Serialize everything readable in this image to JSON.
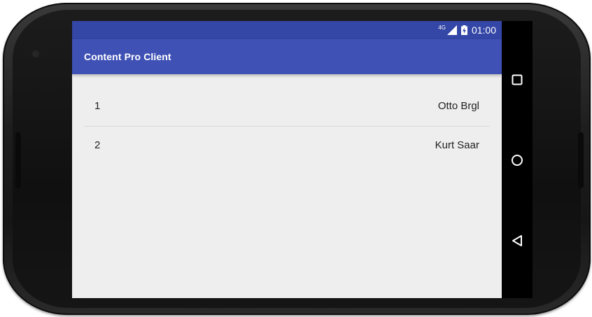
{
  "status_bar": {
    "network": "4G",
    "time": "01:00"
  },
  "app_bar": {
    "title": "Content Pro Client"
  },
  "list": {
    "items": [
      {
        "number": "1",
        "name": "Otto Brgl"
      },
      {
        "number": "2",
        "name": "Kurt Saar"
      }
    ]
  },
  "nav_bar": {
    "icons": [
      "recent-apps-icon",
      "home-icon",
      "back-icon"
    ]
  },
  "colors": {
    "status_bar": "#3446a6",
    "app_bar": "#3f51b5",
    "background": "#eeeeee",
    "nav_bar": "#000000"
  }
}
